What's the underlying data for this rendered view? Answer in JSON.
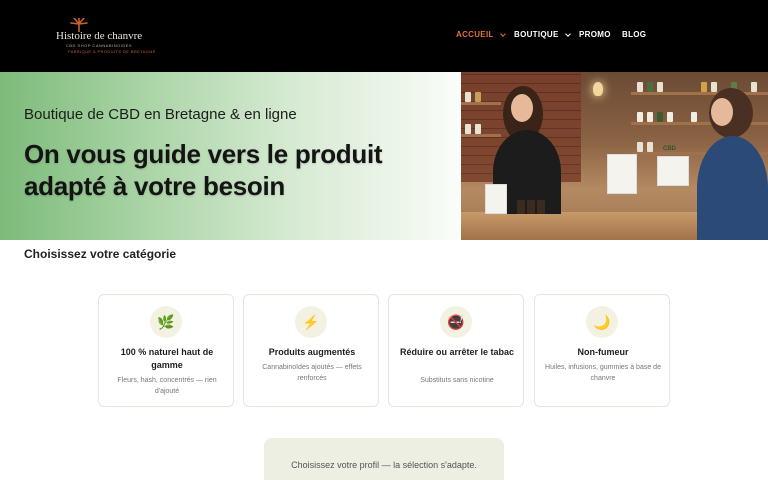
{
  "header": {
    "logo": {
      "title": "Histoire de chanvre",
      "subtitle": "CBD SHOP CANNABINOIDES",
      "tagline": "FABRIQUE & PRODUITS DE BRETAGNE"
    },
    "nav": [
      {
        "label": "ACCUEIL",
        "active": true,
        "has_dropdown": true
      },
      {
        "label": "BOUTIQUE",
        "active": false,
        "has_dropdown": true
      },
      {
        "label": "PROMO",
        "active": false,
        "has_dropdown": false
      },
      {
        "label": "BLOG",
        "active": false,
        "has_dropdown": false
      }
    ]
  },
  "hero": {
    "subtitle": "Boutique de CBD en Bretagne & en ligne",
    "title": "On vous guide vers le produit adapté à votre besoin",
    "photo_label": "CBD"
  },
  "categories": {
    "heading": "Choisissez votre catégorie",
    "items": [
      {
        "icon": "leaf-icon",
        "glyph": "🌿",
        "title": "100 % naturel haut de gamme",
        "description": "Fleurs, hash, concentrés — rien d'ajouté"
      },
      {
        "icon": "lightning-icon",
        "glyph": "⚡",
        "title": "Produits augmentés",
        "description": "Cannabinoïdes ajoutés — effets renforcés"
      },
      {
        "icon": "no-smoking-icon",
        "glyph": "🚭",
        "title": "Réduire ou arrêter le tabac",
        "description": "Substituts sans nicotine"
      },
      {
        "icon": "moon-icon",
        "glyph": "🌙",
        "title": "Non-fumeur",
        "description": "Huiles, infusions, gummies à base de chanvre"
      }
    ]
  },
  "profile": {
    "text": "Choisissez votre profil — la sélection s'adapte."
  },
  "colors": {
    "header_bg": "#000000",
    "nav_active": "#e0703a",
    "hero_green": "#7dbb7a",
    "card_border": "#e3e6d8",
    "profile_bg": "#ecefe2"
  }
}
